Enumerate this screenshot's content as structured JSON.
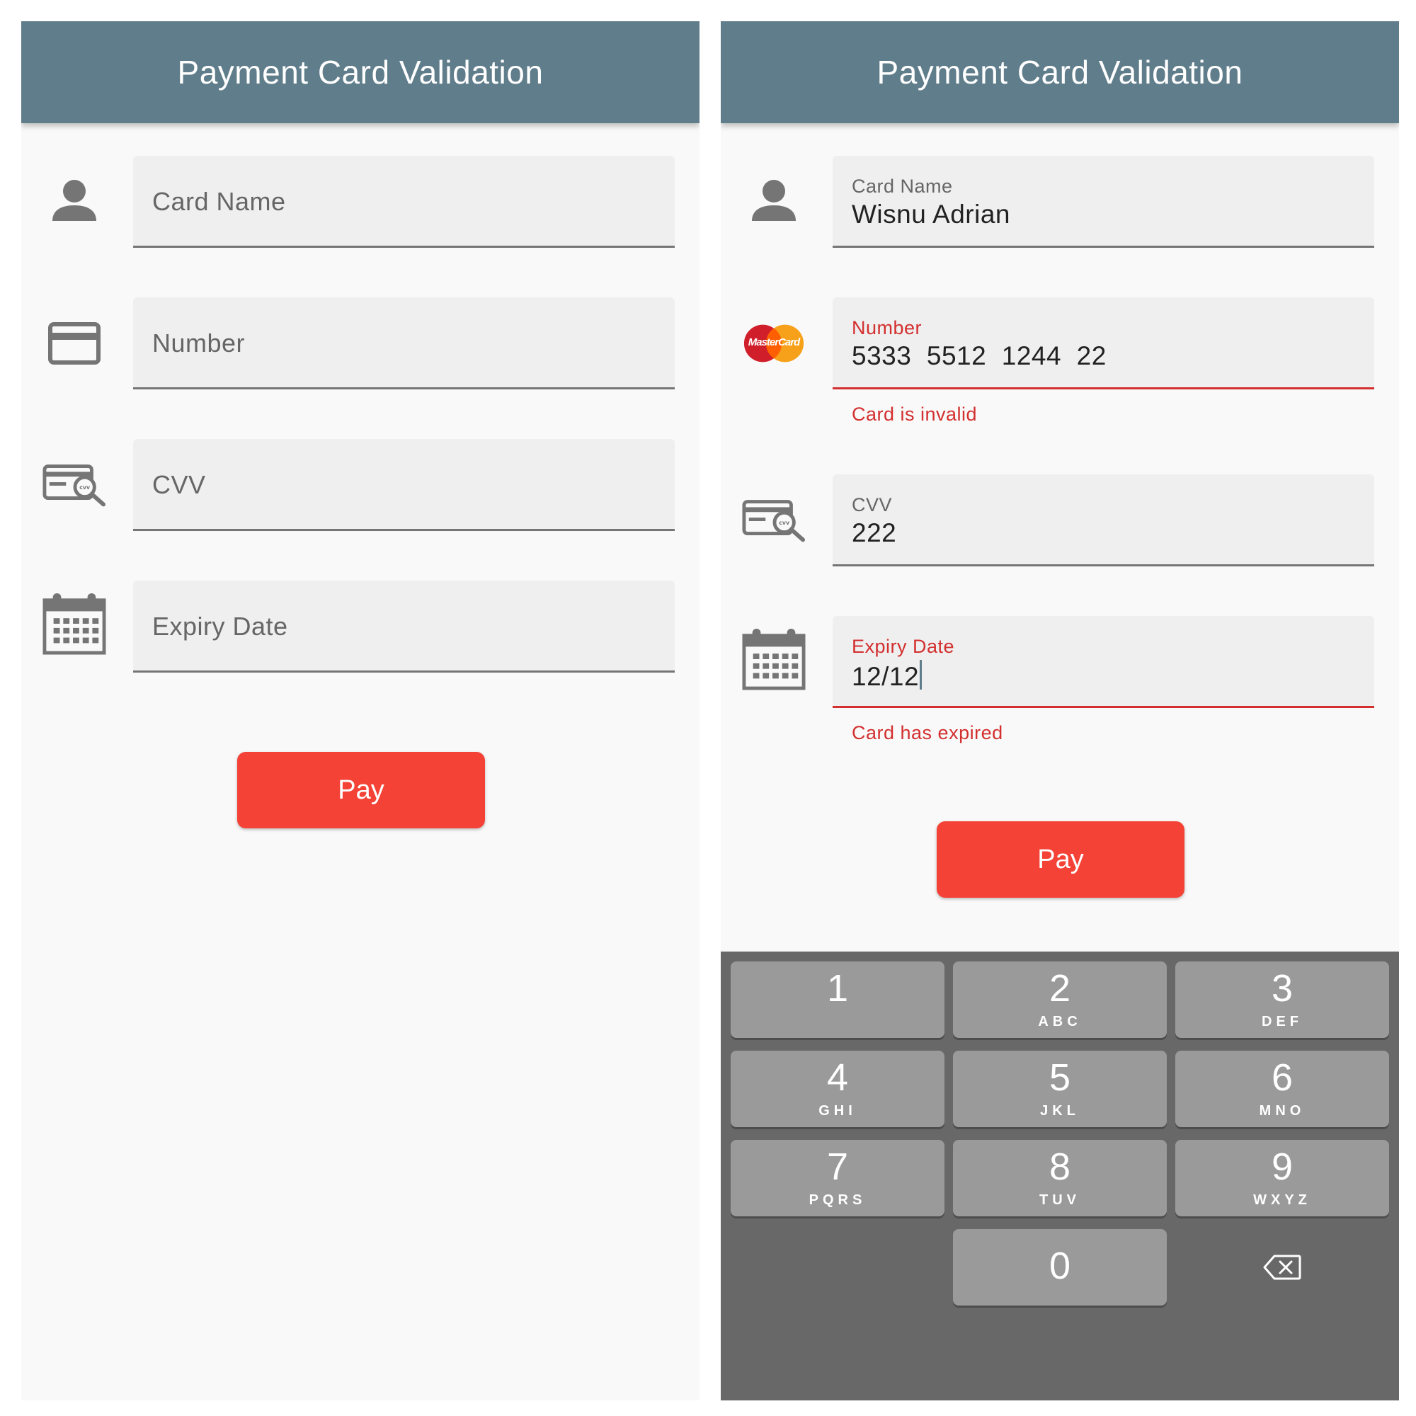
{
  "left_screen": {
    "title": "Payment Card Validation",
    "fields": {
      "card_name": {
        "placeholder": "Card Name"
      },
      "number": {
        "placeholder": "Number"
      },
      "cvv": {
        "placeholder": "CVV"
      },
      "expiry": {
        "placeholder": "Expiry Date"
      }
    },
    "pay_label": "Pay"
  },
  "right_screen": {
    "title": "Payment Card Validation",
    "fields": {
      "card_name": {
        "label": "Card Name",
        "value": "Wisnu Adrian"
      },
      "number": {
        "label": "Number",
        "value": "5333  5512  1244  22",
        "error": "Card is invalid",
        "card_brand": "MasterCard"
      },
      "cvv": {
        "label": "CVV",
        "value": "222"
      },
      "expiry": {
        "label": "Expiry Date",
        "value": "12/12",
        "error": "Card has expired"
      }
    },
    "pay_label": "Pay",
    "keypad": {
      "keys": [
        {
          "num": "1",
          "letters": ""
        },
        {
          "num": "2",
          "letters": "ABC"
        },
        {
          "num": "3",
          "letters": "DEF"
        },
        {
          "num": "4",
          "letters": "GHI"
        },
        {
          "num": "5",
          "letters": "JKL"
        },
        {
          "num": "6",
          "letters": "MNO"
        },
        {
          "num": "7",
          "letters": "PQRS"
        },
        {
          "num": "8",
          "letters": "TUV"
        },
        {
          "num": "9",
          "letters": "WXYZ"
        },
        {
          "num": "0",
          "letters": ""
        }
      ]
    }
  },
  "colors": {
    "app_bar": "#607d8b",
    "pay_button": "#f44336",
    "error": "#d32f2f",
    "field_background": "#efefef",
    "keypad_background": "#686868"
  },
  "icons": {
    "card_name": "person-icon",
    "number_empty": "credit-card-icon",
    "number_filled": "mastercard-logo-icon",
    "cvv": "cvv-search-icon",
    "expiry": "calendar-icon",
    "keypad_delete": "backspace-icon"
  }
}
